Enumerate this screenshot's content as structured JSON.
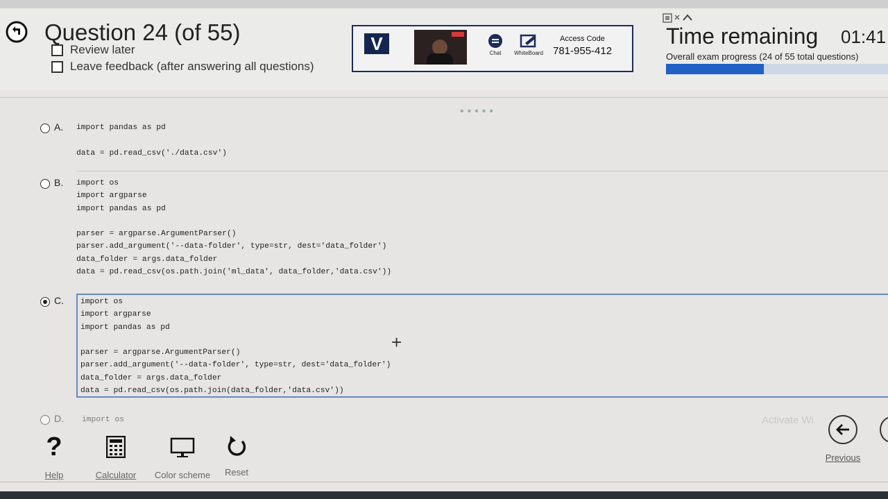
{
  "header": {
    "question_title": "Question 24 (of 55)",
    "review_later": "Review later",
    "leave_feedback": "Leave feedback (after answering all questions)"
  },
  "proctor": {
    "logo": "V",
    "chat_label": "Chat",
    "whiteboard_label": "WhiteBoard",
    "access_code_label": "Access Code",
    "access_code": "781-955-412"
  },
  "timer": {
    "label": "Time remaining",
    "value": "01:41",
    "progress_text": "Overall exam progress (24 of 55 total questions)",
    "progress_fraction": 0.44
  },
  "options": [
    {
      "letter": "A.",
      "selected": false,
      "code": "import pandas as pd\n\ndata = pd.read_csv('./data.csv')"
    },
    {
      "letter": "B.",
      "selected": false,
      "code": "import os\nimport argparse\nimport pandas as pd\n\nparser = argparse.ArgumentParser()\nparser.add_argument('--data-folder', type=str, dest='data_folder')\ndata_folder = args.data_folder\ndata = pd.read_csv(os.path.join('ml_data', data_folder,'data.csv'))"
    },
    {
      "letter": "C.",
      "selected": true,
      "code": "import os\nimport argparse\nimport pandas as pd\n\nparser = argparse.ArgumentParser()\nparser.add_argument('--data-folder', type=str, dest='data_folder')\ndata_folder = args.data_folder\ndata = pd.read_csv(os.path.join(data_folder,'data.csv'))"
    },
    {
      "letter": "D.",
      "selected": false,
      "code": "import os"
    }
  ],
  "toolbar": {
    "help": "Help",
    "calculator": "Calculator",
    "color_scheme": "Color scheme",
    "reset": "Reset",
    "previous": "Previous"
  },
  "watermark": "Activate Wi",
  "colors": {
    "accent": "#2160c4",
    "proctor_border": "#1d2b5a",
    "selected_border": "#6688c2"
  },
  "icons": [
    "back-icon",
    "checkbox-icon",
    "chat-icon",
    "whiteboard-icon",
    "help-icon",
    "calculator-icon",
    "monitor-icon",
    "reset-icon",
    "arrow-left-icon"
  ]
}
